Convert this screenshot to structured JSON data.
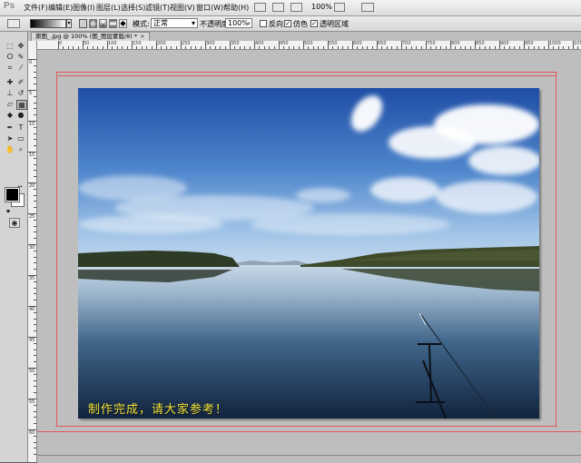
{
  "app": {
    "logo": "Ps"
  },
  "menubar": {
    "items": [
      "文件(F)",
      "编辑(E)",
      "图像(I)",
      "图层(L)",
      "选择(S)",
      "滤镜(T)",
      "视图(V)",
      "窗口(W)",
      "帮助(H)"
    ],
    "zoom_value": "100%"
  },
  "options": {
    "mode_label": "模式:",
    "mode_value": "正常",
    "opacity_label": "不透明度:",
    "opacity_value": "100%",
    "reverse_label": "反向",
    "reverse_checked": false,
    "dither_label": "仿色",
    "dither_checked": true,
    "transparency_label": "透明区域",
    "transparency_checked": true
  },
  "document": {
    "tab_title": "原图_.jpg @ 100% (图_图层蒙版/8) *",
    "close_glyph": "×"
  },
  "ruler": {
    "h_labels": [
      "0",
      "50",
      "100",
      "150",
      "200",
      "250",
      "300",
      "350",
      "400",
      "450",
      "500",
      "550",
      "600",
      "650",
      "700",
      "750",
      "800",
      "850",
      "900",
      "950",
      "1000",
      "1050"
    ],
    "v_labels": [
      "0",
      "5",
      "10",
      "15",
      "20",
      "25",
      "30",
      "35",
      "40",
      "45",
      "50",
      "55",
      "60"
    ]
  },
  "canvas": {
    "caption": "制作完成，请大家参考！"
  },
  "colors": {
    "foreground": "#000000",
    "background": "#ffffff",
    "guide": "#e05a5a",
    "caption": "#f3e23a"
  }
}
